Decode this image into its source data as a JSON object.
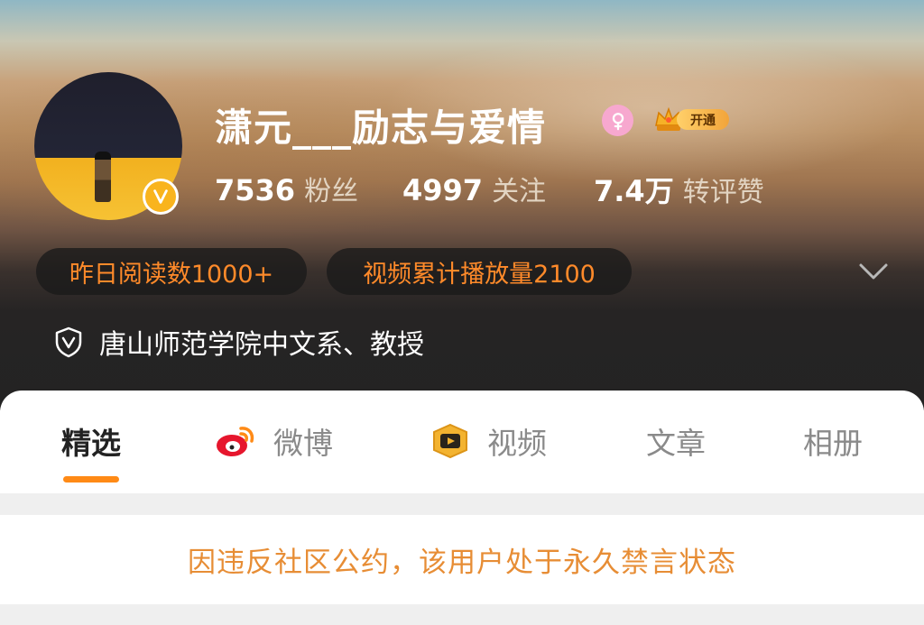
{
  "profile": {
    "username": "潇元___励志与爱情",
    "verified_type": "verified-v",
    "gender_icon": "female-icon",
    "vip_badge_label": "开通",
    "stats": [
      {
        "value": "7536",
        "label": "粉丝"
      },
      {
        "value": "4997",
        "label": "关注"
      },
      {
        "value": "7.4万",
        "label": "转评赞"
      }
    ],
    "highlights": [
      "昨日阅读数1000+",
      "视频累计播放量2100"
    ],
    "certification": "唐山师范学院中文系、教授"
  },
  "tabs": [
    {
      "label": "精选",
      "active": true,
      "icon": ""
    },
    {
      "label": "微博",
      "active": false,
      "icon": "weibo-icon"
    },
    {
      "label": "视频",
      "active": false,
      "icon": "video-icon"
    },
    {
      "label": "文章",
      "active": false,
      "icon": ""
    },
    {
      "label": "相册",
      "active": false,
      "icon": ""
    }
  ],
  "notice": "因违反社区公约，该用户处于永久禁言状态",
  "colors": {
    "accent_orange": "#ff8a16",
    "notice_orange": "#e78d35",
    "badge_gold": "#f9b41d"
  }
}
